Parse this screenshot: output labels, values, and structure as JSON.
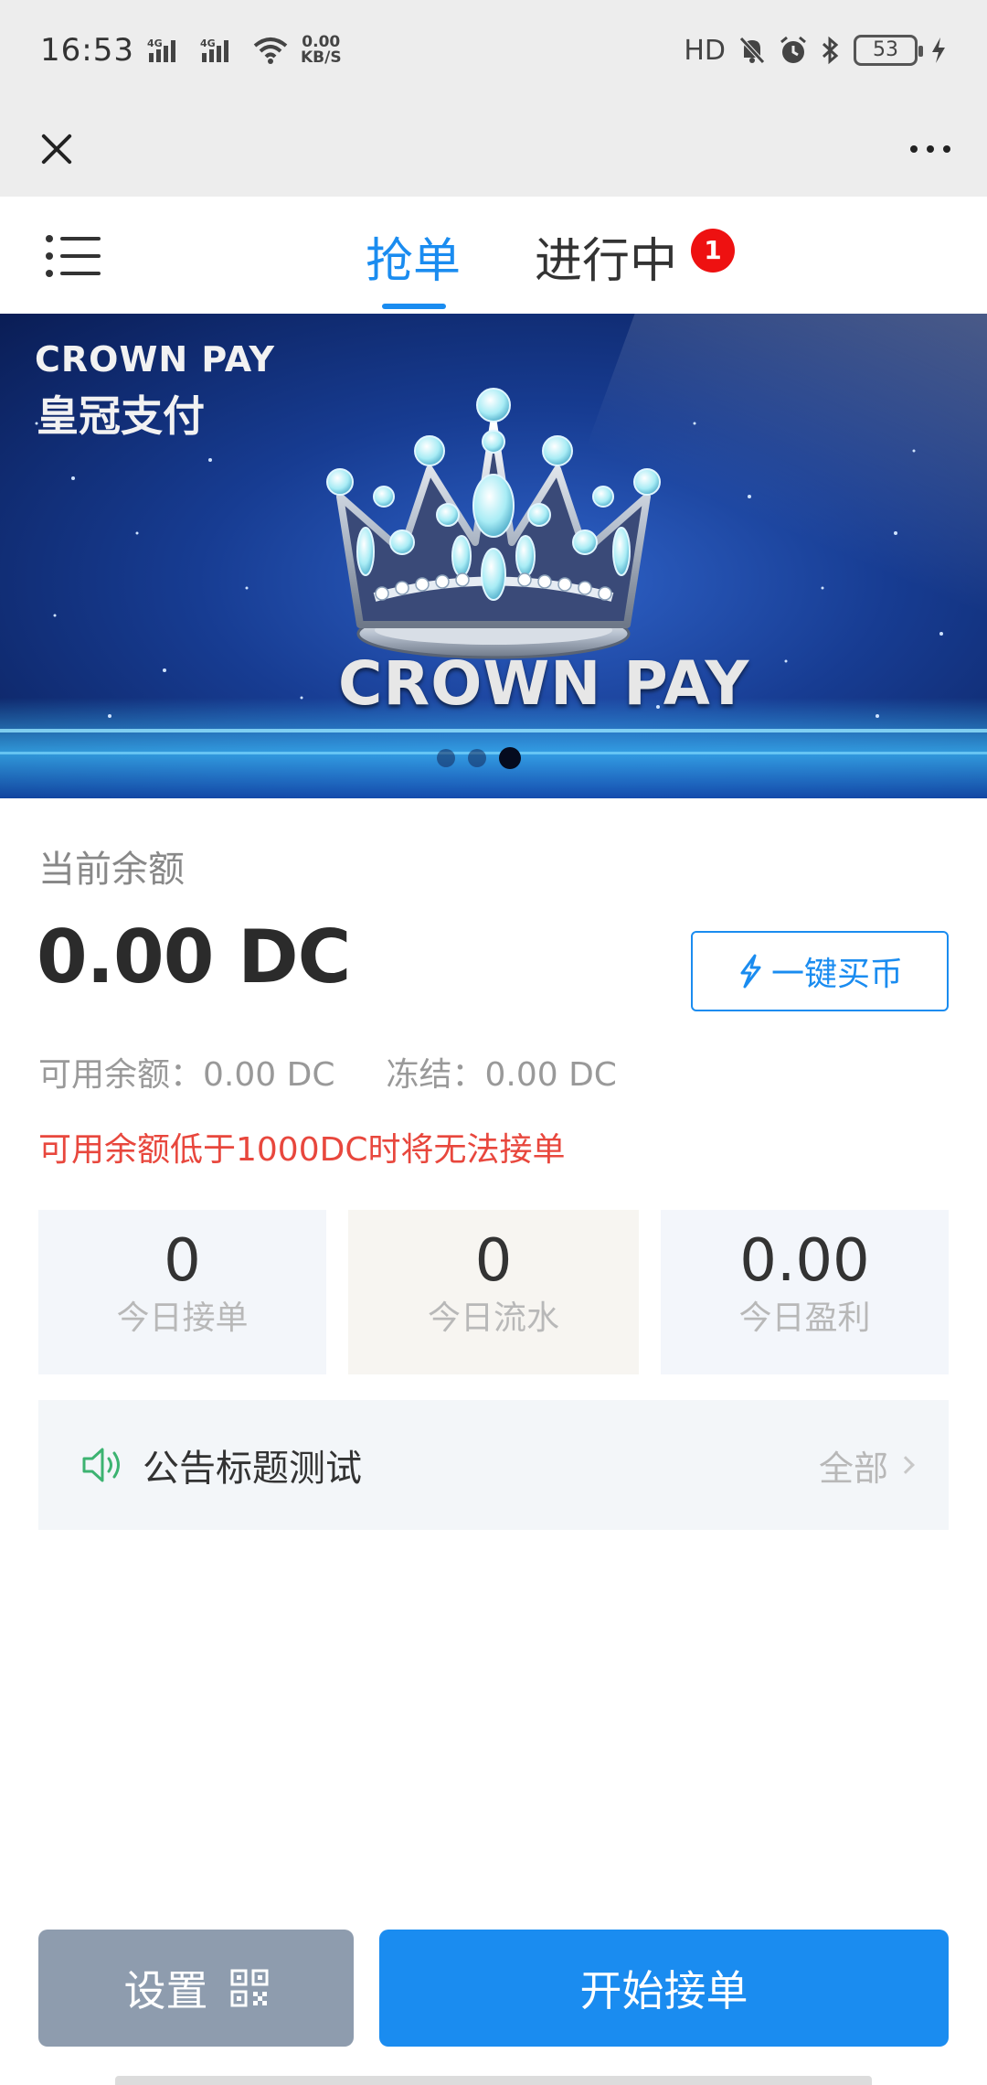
{
  "status_bar": {
    "time": "16:53",
    "network_speed": "0.00",
    "network_unit": "KB/S",
    "hd_label": "HD",
    "battery": "53"
  },
  "top_nav": {
    "tabs": [
      {
        "label": "抢单",
        "active": true
      },
      {
        "label": "进行中",
        "active": false
      }
    ],
    "badge_count": "1"
  },
  "banner": {
    "brand_en": "CROWN PAY",
    "brand_cn": "皇冠支付",
    "logo_text": "CROWN PAY",
    "slide_count": 3,
    "active_slide": 3
  },
  "balance": {
    "label": "当前余额",
    "amount": "0.00 DC",
    "buy_button": "一键买币",
    "available": "可用余额：0.00 DC",
    "frozen": "冻结：0.00 DC",
    "warning": "可用余额低于1000DC时将无法接单"
  },
  "stats": [
    {
      "value": "0",
      "label": "今日接单"
    },
    {
      "value": "0",
      "label": "今日流水"
    },
    {
      "value": "0.00",
      "label": "今日盈利"
    }
  ],
  "notice": {
    "title": "公告标题测试",
    "all_label": "全部"
  },
  "actions": {
    "settings_label": "设置",
    "start_label": "开始接单"
  },
  "colors": {
    "accent": "#1a8cf0",
    "warning": "#e8473d",
    "badge": "#ee1111",
    "settings_button": "#8e9cae",
    "speaker_icon": "#3cb371"
  }
}
